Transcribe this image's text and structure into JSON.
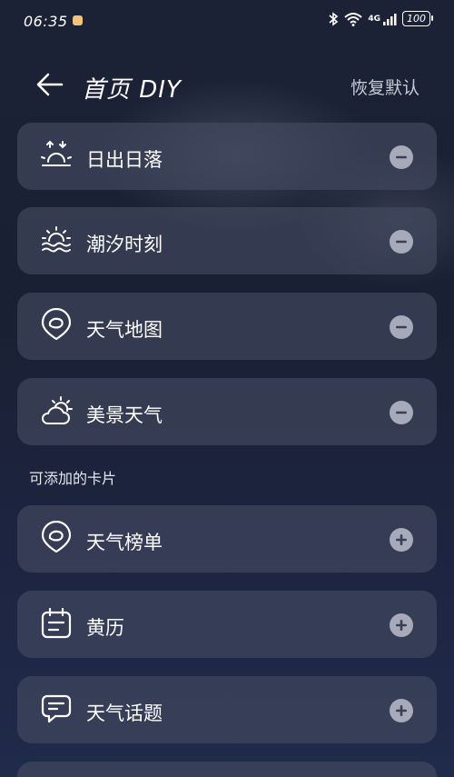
{
  "status_bar": {
    "time": "06:35",
    "network": "4G",
    "battery": "100"
  },
  "header": {
    "title": "首页 DIY",
    "reset_label": "恢复默认"
  },
  "added_cards": [
    {
      "label": "日出日落",
      "icon": "sunrise-icon"
    },
    {
      "label": "潮汐时刻",
      "icon": "tide-icon"
    },
    {
      "label": "天气地图",
      "icon": "map-pin-icon"
    },
    {
      "label": "美景天气",
      "icon": "sun-cloud-icon"
    }
  ],
  "section_title": "可添加的卡片",
  "available_cards": [
    {
      "label": "天气榜单",
      "icon": "ranking-icon"
    },
    {
      "label": "黄历",
      "icon": "calendar-icon"
    },
    {
      "label": "天气话题",
      "icon": "chat-icon"
    }
  ],
  "colors": {
    "background": "#1c2236",
    "card": "#464c62",
    "action_button": "#a7aab8"
  }
}
